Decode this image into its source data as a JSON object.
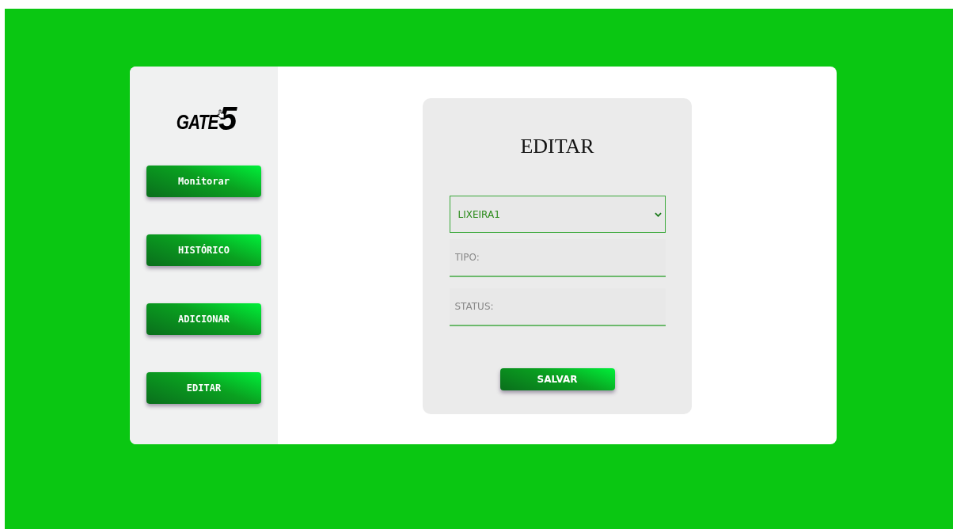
{
  "logo": {
    "word": "GATE",
    "digit": "5"
  },
  "sidebar": {
    "items": [
      {
        "label": "Monitorar"
      },
      {
        "label": "HISTÓRICO"
      },
      {
        "label": "ADICIONAR"
      },
      {
        "label": "EDITAR"
      }
    ]
  },
  "form": {
    "title": "EDITAR",
    "select": {
      "value": "LIXEIRA1"
    },
    "fields": [
      {
        "placeholder": "TIPO:"
      },
      {
        "placeholder": "STATUS:"
      }
    ],
    "submit": "SALVAR"
  }
}
